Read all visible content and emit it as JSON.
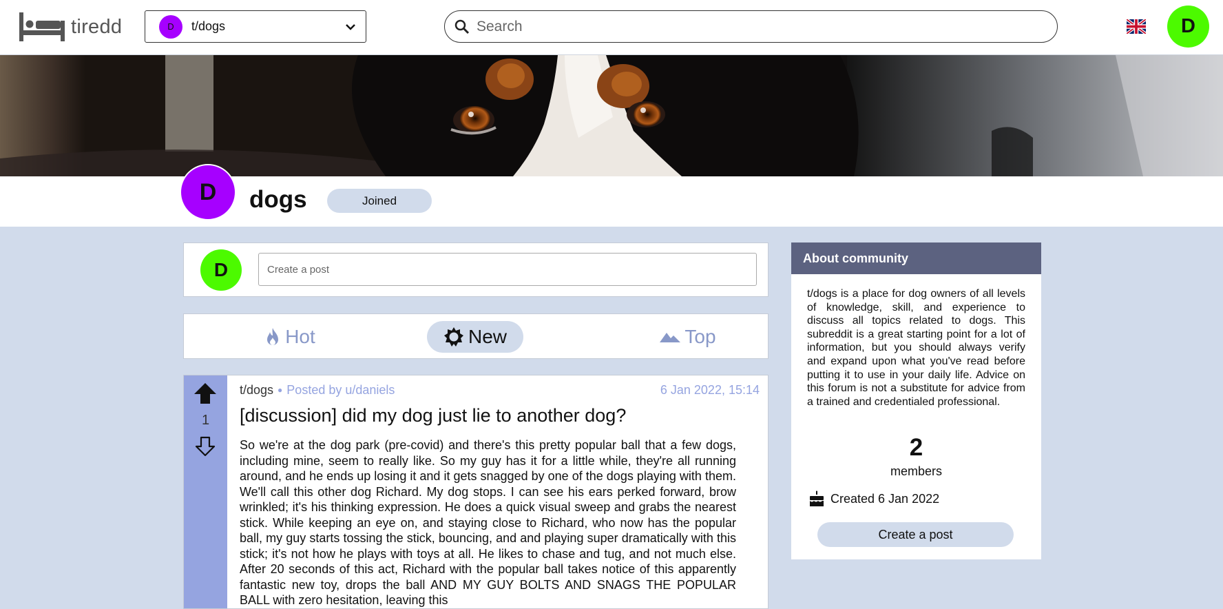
{
  "header": {
    "app_name": "tiredd",
    "subreddit_select": {
      "avatar_letter": "D",
      "value": "t/dogs"
    },
    "search": {
      "placeholder": "Search"
    },
    "language_icon": "uk-flag-icon",
    "user_avatar_letter": "D"
  },
  "community": {
    "avatar_letter": "D",
    "name": "dogs",
    "joined_label": "Joined"
  },
  "create_post": {
    "avatar_letter": "D",
    "placeholder": "Create a post"
  },
  "sort": {
    "hot_label": "Hot",
    "new_label": "New",
    "top_label": "Top",
    "active": "New"
  },
  "post": {
    "score": "1",
    "subreddit": "t/dogs",
    "posted_by": "Posted by u/daniels",
    "date": "6 Jan 2022, 15:14",
    "title": "[discussion] did my dog just lie to another dog?",
    "body": "So we're at the dog park (pre-covid) and there's this pretty popular ball that a few dogs, including mine, seem to really like. So my guy has it for a little while, they're all running around, and he ends up losing it and it gets snagged by one of the dogs playing with them. We'll call this other dog Richard. My dog stops. I can see his ears perked forward, brow wrinkled; it's his thinking expression. He does a quick visual sweep and grabs the nearest stick. While keeping an eye on, and staying close to Richard, who now has the popular ball, my guy starts tossing the stick, bouncing, and and playing super dramatically with this stick; it's not how he plays with toys at all. He likes to chase and tug, and not much else. After 20 seconds of this act, Richard with the popular ball takes notice of this apparently fantastic new toy, drops the ball AND MY GUY BOLTS AND SNAGS THE POPULAR BALL with zero hesitation, leaving this"
  },
  "about": {
    "heading": "About community",
    "description": "t/dogs is a place for dog owners of all levels of knowledge, skill, and experience to discuss all topics related to dogs. This subreddit is a great starting point for a lot of information, but you should always verify and expand upon what you've read before putting it to use in your daily life. Advice on this forum is not a substitute for advice from a trained and credentialed professional.",
    "members_count": "2",
    "members_label": "members",
    "created": "Created 6 Jan 2022",
    "create_post_button": "Create a post"
  },
  "colors": {
    "accent": "#95a4e0",
    "page_bg": "#d1dbeb",
    "about_header": "#5c6280",
    "user_avatar": "#4cfa00",
    "community_avatar": "#a600ff"
  }
}
